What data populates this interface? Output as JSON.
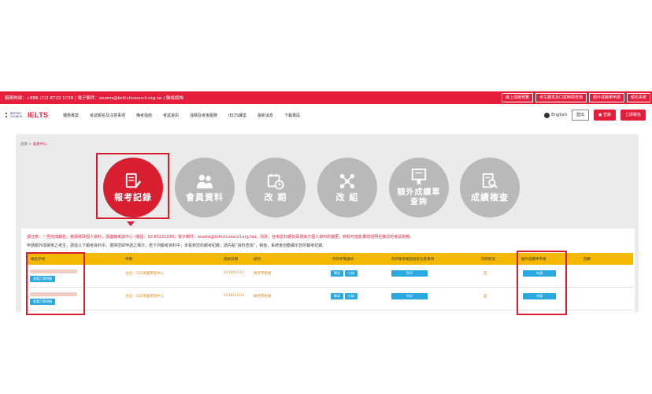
{
  "topbar": {
    "contact": "服務熱線：+886 (0)2 8722 1039 | 電子郵件：exams@britishcouncil.org.tw | 聯絡諮詢",
    "buttons": [
      "線上成績預覽",
      "考生聽寫及口試時間查詢",
      "額外成績單申請",
      "報名系統"
    ]
  },
  "nav": {
    "logo_bc": "BRITISH COUNCIL",
    "logo_ielts": "IELTS",
    "menu": [
      "優惠專案",
      "考試報名及注意事項",
      "備考指南",
      "考試資訊",
      "成績及考後服務",
      "IELTS課堂",
      "最新消息",
      "下載專區"
    ],
    "lang": "English",
    "logout": "登出",
    "register": "登錄",
    "signup": "立即報名"
  },
  "breadcrumb": {
    "home": "首頁 > ",
    "current": "會員中心"
  },
  "tiles": [
    {
      "label": "報考記錄",
      "icon": "pen-document-icon",
      "active": true
    },
    {
      "label": "會員資料",
      "icon": "people-icon",
      "active": false
    },
    {
      "label": "改 期",
      "icon": "calendar-clock-icon",
      "active": false
    },
    {
      "label": "改 組",
      "icon": "network-icon",
      "active": false
    },
    {
      "label": "額外成績單查詢",
      "icon": "certificate-icon",
      "active": false
    },
    {
      "label": "成績複查",
      "icon": "search-document-icon",
      "active": false
    }
  ],
  "notes": {
    "line1": "請注意：一旦完成報名，將請修改個人資料，請連絡考試中心 (電話：02 87221039，電子郵件：exams@britishcouncil.org.tw)。另外，在考試日期前兩週後方個人資料的變更，將有可能影響您證明名條次的考試資格。",
    "line2": "申請額外成績單之考生，請從以下報考資料中，選擇您欲申請之場次，若下列報考資料中，未看到您的報考紀錄，請先點“資料查詢”，稍後，系統會自動顯示您的報考紀錄。"
  },
  "table": {
    "headers": [
      "報名序號",
      "考場",
      "測試日期",
      "組別",
      "列印考場通知",
      "列印報考確認函及注意事項",
      "列印狀況",
      "額外成績單申請",
      "回郵"
    ],
    "rows": [
      {
        "detail_btn": "查看訂單明細",
        "venue": "台北 - CES英國學習中心",
        "date": "2019/01/12",
        "group": "隨考學術組",
        "print_a": "筆試",
        "print_b": "口試",
        "print_confirm": "列印",
        "status": "是",
        "apply": "申請"
      },
      {
        "detail_btn": "查看訂單明細",
        "venue": "台北 - CES英國學習中心",
        "date": "2018/11/03",
        "group": "隨考學術組",
        "print_a": "筆試",
        "print_b": "口試",
        "print_confirm": "列印",
        "status": "是",
        "apply": "申請"
      }
    ]
  },
  "colors": {
    "brand_red": "#e41d3a",
    "table_header": "#f5b800",
    "button_blue": "#29a9e0",
    "tile_gray": "#b9b9b9"
  }
}
